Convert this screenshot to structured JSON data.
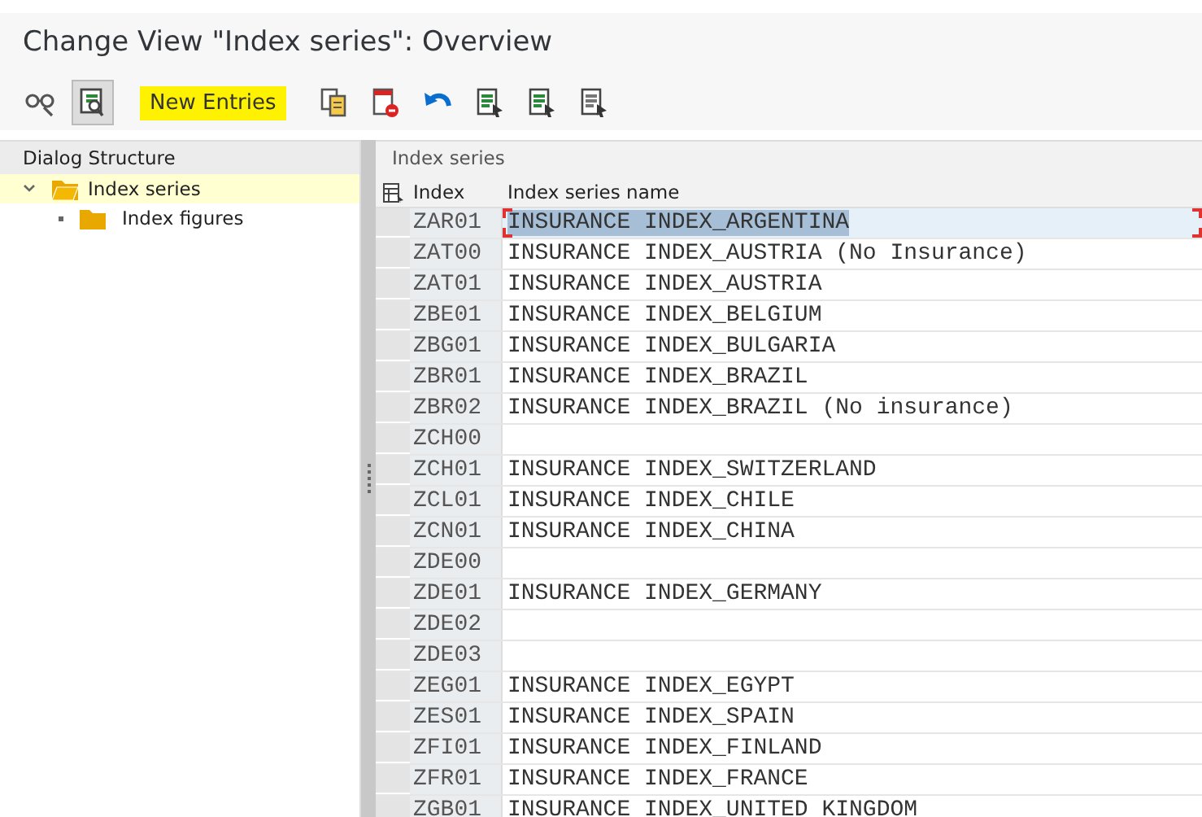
{
  "window": {
    "title": "Change View \"Index series\": Overview"
  },
  "toolbar": [
    {
      "kind": "glasses",
      "pressed": false
    },
    {
      "kind": "display",
      "pressed": true
    },
    {
      "kind": "text",
      "label": "New Entries",
      "highlighted": true,
      "pressed": false
    },
    {
      "kind": "copy",
      "pressed": false
    },
    {
      "kind": "delete",
      "pressed": false
    },
    {
      "kind": "undo",
      "pressed": false
    },
    {
      "kind": "select-all",
      "pressed": false
    },
    {
      "kind": "select-block",
      "pressed": false
    },
    {
      "kind": "deselect",
      "pressed": false
    }
  ],
  "dialog_structure": {
    "title": "Dialog Structure",
    "items": [
      {
        "label": "Index series",
        "expanded": true,
        "selected": true,
        "children": [
          {
            "label": "Index figures",
            "selected": false
          }
        ]
      }
    ]
  },
  "table": {
    "title": "Index series",
    "columns": [
      "Index",
      "Index series name"
    ],
    "rows": [
      {
        "index": "ZAR01",
        "name": "INSURANCE INDEX_ARGENTINA",
        "selected": true
      },
      {
        "index": "ZAT00",
        "name": "INSURANCE INDEX_AUSTRIA (No Insurance)",
        "selected": false
      },
      {
        "index": "ZAT01",
        "name": "INSURANCE INDEX_AUSTRIA",
        "selected": false
      },
      {
        "index": "ZBE01",
        "name": "INSURANCE INDEX_BELGIUM",
        "selected": false
      },
      {
        "index": "ZBG01",
        "name": "INSURANCE INDEX_BULGARIA",
        "selected": false
      },
      {
        "index": "ZBR01",
        "name": "INSURANCE INDEX_BRAZIL",
        "selected": false
      },
      {
        "index": "ZBR02",
        "name": "INSURANCE INDEX_BRAZIL (No insurance)",
        "selected": false
      },
      {
        "index": "ZCH00",
        "selected": false
      },
      {
        "index": "ZCH01",
        "name": "INSURANCE INDEX_SWITZERLAND",
        "selected": false
      },
      {
        "index": "ZCL01",
        "name": "INSURANCE INDEX_CHILE",
        "selected": false
      },
      {
        "index": "ZCN01",
        "name": "INSURANCE INDEX_CHINA",
        "selected": false
      },
      {
        "index": "ZDE00",
        "selected": false
      },
      {
        "index": "ZDE01",
        "name": "INSURANCE INDEX_GERMANY",
        "selected": false
      },
      {
        "index": "ZDE02",
        "selected": false
      },
      {
        "index": "ZDE03",
        "selected": false
      },
      {
        "index": "ZEG01",
        "name": "INSURANCE INDEX_EGYPT",
        "selected": false
      },
      {
        "index": "ZES01",
        "name": "INSURANCE INDEX_SPAIN",
        "selected": false
      },
      {
        "index": "ZFI01",
        "name": "INSURANCE INDEX_FINLAND",
        "selected": false
      },
      {
        "index": "ZFR01",
        "name": "INSURANCE INDEX_FRANCE",
        "selected": false
      },
      {
        "index": "ZGB01",
        "name": "INSURANCE INDEX_UNITED KINGDOM",
        "selected": false
      }
    ]
  }
}
